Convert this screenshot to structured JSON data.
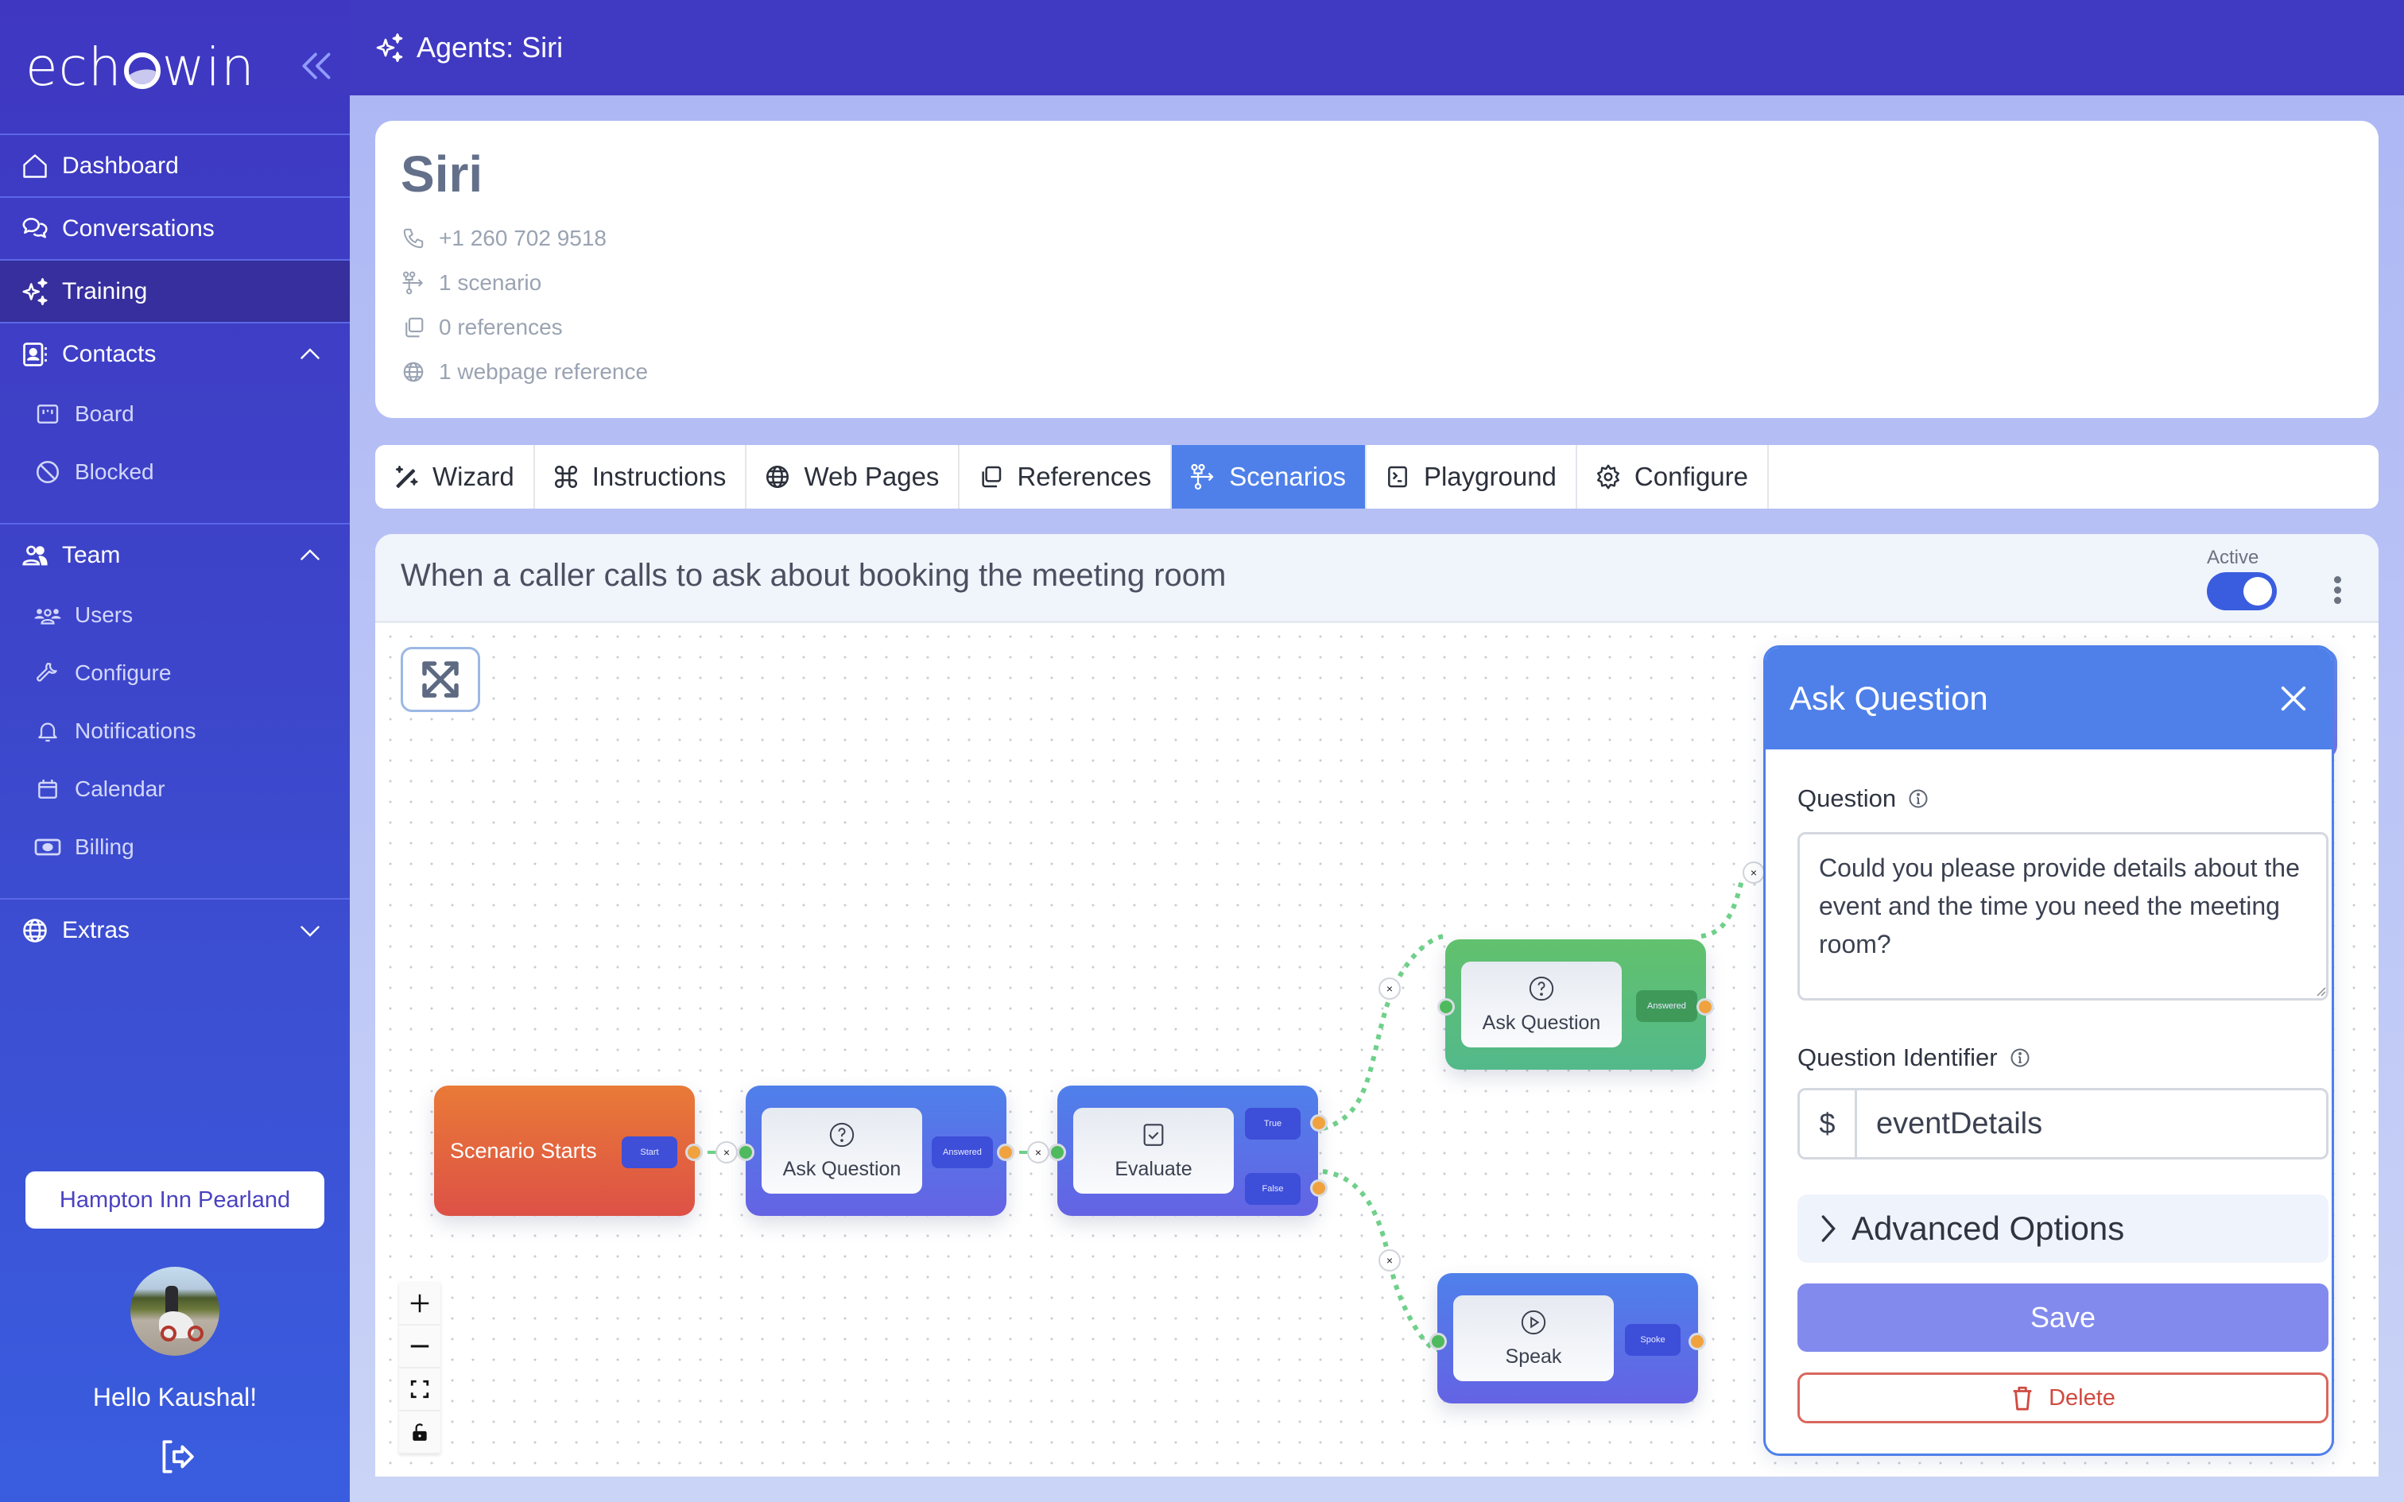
{
  "app": {
    "brand": {
      "prefix": "ech",
      "suffix": "win"
    },
    "colors": {
      "sidebar": "#3f37c1",
      "header": "#4039c2",
      "accent": "#4f80ea",
      "active_nav": "#372f9d",
      "node_start": "#e97a37",
      "node_blue": "#4f80ea",
      "node_green": "#61c16d",
      "edge": "#6fd08a",
      "save": "#828bed",
      "danger": "#d04a40"
    }
  },
  "sidebar": {
    "collapse_icon": "chevrons-left-icon",
    "items": [
      {
        "label": "Dashboard",
        "icon": "home-icon",
        "active": false
      },
      {
        "label": "Conversations",
        "icon": "chat-bubbles-icon",
        "active": false
      },
      {
        "label": "Training",
        "icon": "sparkles-icon",
        "active": true
      }
    ],
    "groups": [
      {
        "label": "Contacts",
        "icon": "contact-book-icon",
        "expanded": true,
        "children": [
          {
            "label": "Board",
            "icon": "board-icon"
          },
          {
            "label": "Blocked",
            "icon": "blocked-icon"
          }
        ]
      },
      {
        "label": "Team",
        "icon": "team-icon",
        "expanded": true,
        "children": [
          {
            "label": "Users",
            "icon": "users-icon"
          },
          {
            "label": "Configure",
            "icon": "wrench-icon"
          },
          {
            "label": "Notifications",
            "icon": "bell-icon"
          },
          {
            "label": "Calendar",
            "icon": "calendar-icon"
          },
          {
            "label": "Billing",
            "icon": "money-icon"
          }
        ]
      },
      {
        "label": "Extras",
        "icon": "globe-icon",
        "expanded": false,
        "children": []
      }
    ],
    "organization": "Hampton Inn Pearland",
    "greeting": "Hello Kaushal!",
    "logout_icon": "logout-icon"
  },
  "header": {
    "icon": "sparkles-icon",
    "title": "Agents: Siri"
  },
  "agent": {
    "name": "Siri",
    "meta": [
      {
        "icon": "phone-icon",
        "text": "+1 260 702 9518"
      },
      {
        "icon": "scenario-icon",
        "text": "1 scenario"
      },
      {
        "icon": "copy-icon",
        "text": "0 references"
      },
      {
        "icon": "globe-icon",
        "text": "1 webpage reference"
      }
    ]
  },
  "tabs": [
    {
      "label": "Wizard",
      "icon": "magic-wand-icon",
      "active": false
    },
    {
      "label": "Instructions",
      "icon": "command-icon",
      "active": false
    },
    {
      "label": "Web Pages",
      "icon": "globe-icon",
      "active": false
    },
    {
      "label": "References",
      "icon": "copy-icon",
      "active": false
    },
    {
      "label": "Scenarios",
      "icon": "scenario-icon",
      "active": true
    },
    {
      "label": "Playground",
      "icon": "terminal-icon",
      "active": false
    },
    {
      "label": "Configure",
      "icon": "gear-icon",
      "active": false
    }
  ],
  "scenario": {
    "title": "When a caller calls to ask about booking the meeting room",
    "status_label": "Active",
    "active": true,
    "canvas": {
      "expand_icon": "expand-arrows-icon",
      "controls": [
        {
          "name": "zoom-in",
          "icon": "plus-icon"
        },
        {
          "name": "zoom-out",
          "icon": "minus-icon"
        },
        {
          "name": "fit-view",
          "icon": "fit-view-icon"
        },
        {
          "name": "lock",
          "icon": "unlock-icon"
        }
      ],
      "nodes": [
        {
          "id": "start",
          "type": "start",
          "label": "Scenario Starts",
          "outputs": [
            "Start"
          ]
        },
        {
          "id": "ask1",
          "type": "ask",
          "label": "Ask Question",
          "icon": "question-circle-icon",
          "outputs": [
            "Answered"
          ]
        },
        {
          "id": "eval",
          "type": "evaluate",
          "label": "Evaluate",
          "icon": "check-square-icon",
          "outputs": [
            "True",
            "False"
          ]
        },
        {
          "id": "ask2",
          "type": "ask",
          "label": "Ask Question",
          "icon": "question-circle-icon",
          "outputs": [
            "Answered"
          ],
          "selected": true
        },
        {
          "id": "speak",
          "type": "speak",
          "label": "Speak",
          "icon": "play-circle-icon",
          "outputs": [
            "Spoke"
          ]
        },
        {
          "id": "speak2",
          "type": "speak",
          "label": "Speak",
          "icon": "play-circle-icon",
          "outputs": [],
          "obscured": true
        }
      ],
      "edges": [
        {
          "from": "start",
          "output": "Start",
          "to": "ask1"
        },
        {
          "from": "ask1",
          "output": "Answered",
          "to": "eval"
        },
        {
          "from": "eval",
          "output": "True",
          "to": "ask2"
        },
        {
          "from": "eval",
          "output": "False",
          "to": "speak"
        },
        {
          "from": "ask2",
          "output": "Answered",
          "to": "speak2"
        }
      ],
      "edge_delete_glyph": "×"
    }
  },
  "panel": {
    "title": "Ask Question",
    "question_label": "Question",
    "question_value": "Could you please provide details about the event and the time you need the meeting room?",
    "identifier_label": "Question Identifier",
    "identifier_prefix": "$",
    "identifier_value": "eventDetails",
    "advanced_label": "Advanced Options",
    "save_label": "Save",
    "delete_label": "Delete"
  }
}
